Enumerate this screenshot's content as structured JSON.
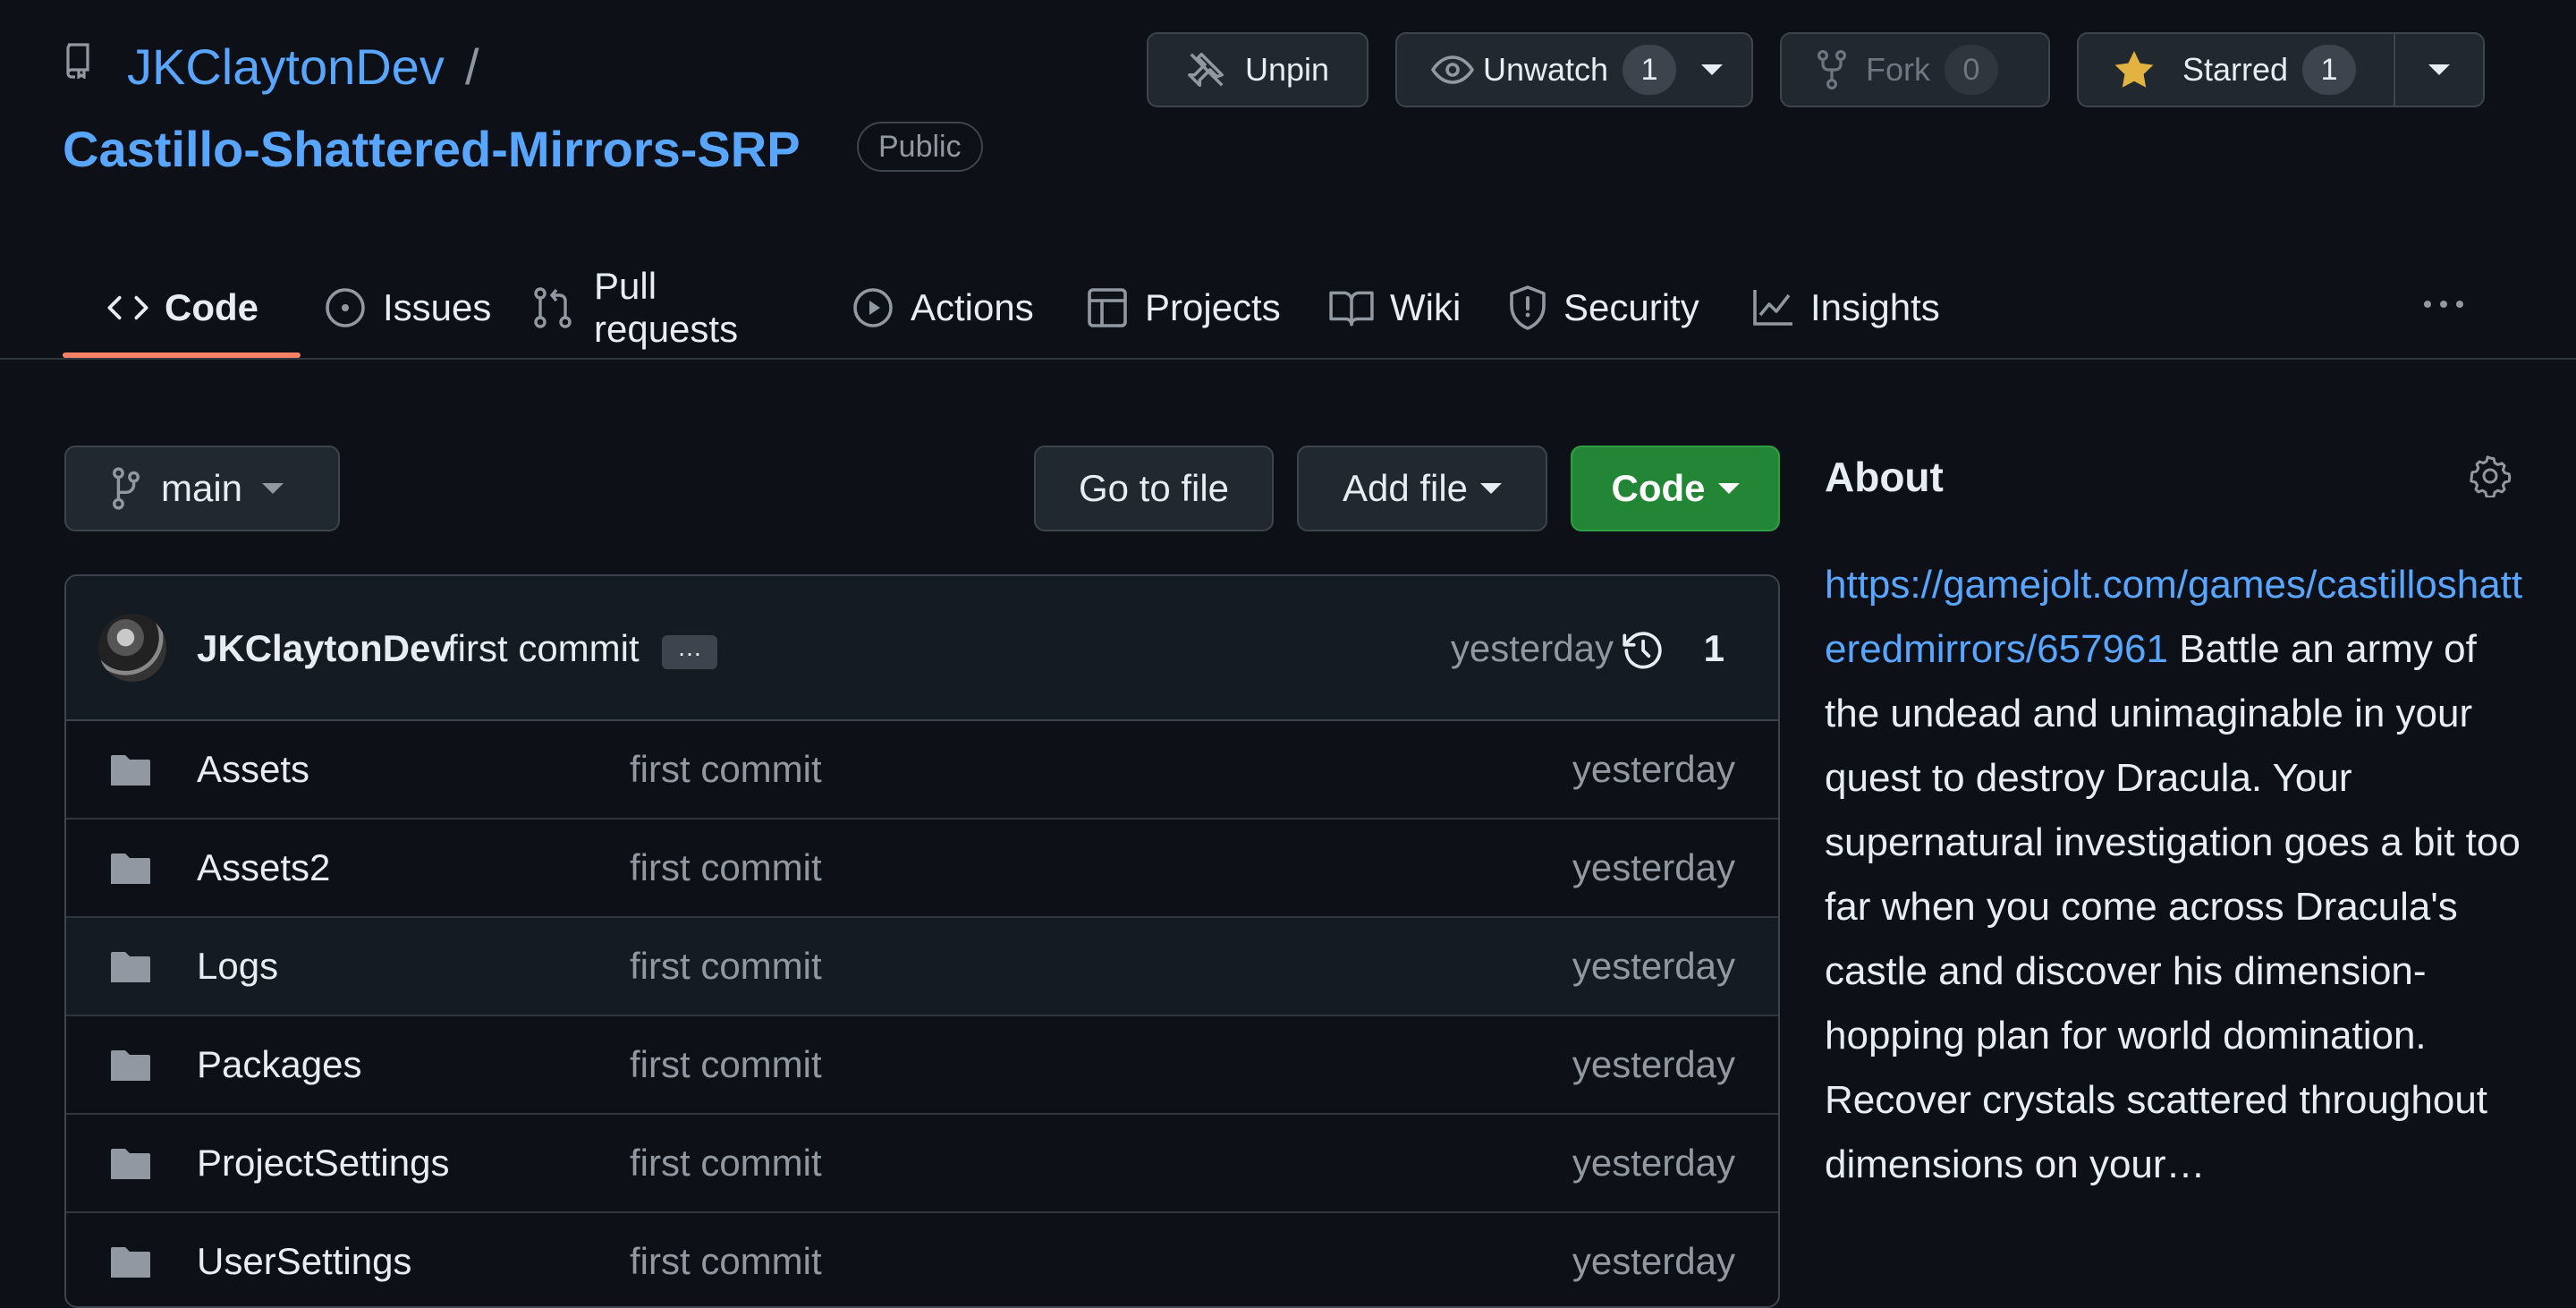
{
  "repo": {
    "owner": "JKClaytonDev",
    "separator": "/",
    "name": "Castillo-Shattered-Mirrors-SRP",
    "visibility": "Public"
  },
  "header_buttons": {
    "unpin": "Unpin",
    "unwatch": "Unwatch",
    "unwatch_count": "1",
    "fork": "Fork",
    "fork_count": "0",
    "starred": "Starred",
    "star_count": "1"
  },
  "tabs": [
    {
      "label": "Code",
      "icon": "code-icon"
    },
    {
      "label": "Issues",
      "icon": "issue-opened-icon"
    },
    {
      "label": "Pull requests",
      "icon": "git-pull-request-icon"
    },
    {
      "label": "Actions",
      "icon": "play-icon"
    },
    {
      "label": "Projects",
      "icon": "table-icon"
    },
    {
      "label": "Wiki",
      "icon": "book-icon"
    },
    {
      "label": "Security",
      "icon": "shield-icon"
    },
    {
      "label": "Insights",
      "icon": "graph-icon"
    }
  ],
  "toolbar": {
    "branch": "main",
    "go_to_file": "Go to file",
    "add_file": "Add file",
    "code": "Code"
  },
  "latest_commit": {
    "author": "JKClaytonDev",
    "message": "first commit",
    "more": "…",
    "time": "yesterday",
    "commit_count": "1"
  },
  "files": [
    {
      "name": "Assets",
      "commit": "first commit",
      "time": "yesterday"
    },
    {
      "name": "Assets2",
      "commit": "first commit",
      "time": "yesterday"
    },
    {
      "name": "Logs",
      "commit": "first commit",
      "time": "yesterday"
    },
    {
      "name": "Packages",
      "commit": "first commit",
      "time": "yesterday"
    },
    {
      "name": "ProjectSettings",
      "commit": "first commit",
      "time": "yesterday"
    },
    {
      "name": "UserSettings",
      "commit": "first commit",
      "time": "yesterday"
    }
  ],
  "about": {
    "title": "About",
    "link": "https://gamejolt.com/games/castilloshatteredmirrors/657961",
    "description": "Battle an army of the undead and unimaginable in your quest to destroy Dracula. Your supernatural investigation goes a bit too far when you come across Dracula's castle and discover his dimension-hopping plan for world domination. Recover crystals scattered throughout dimensions on your…"
  },
  "colors": {
    "background": "#0d1117",
    "link": "#58a6ff",
    "accent_underline": "#f78166",
    "primary_button": "#238636",
    "star": "#e3b341"
  }
}
